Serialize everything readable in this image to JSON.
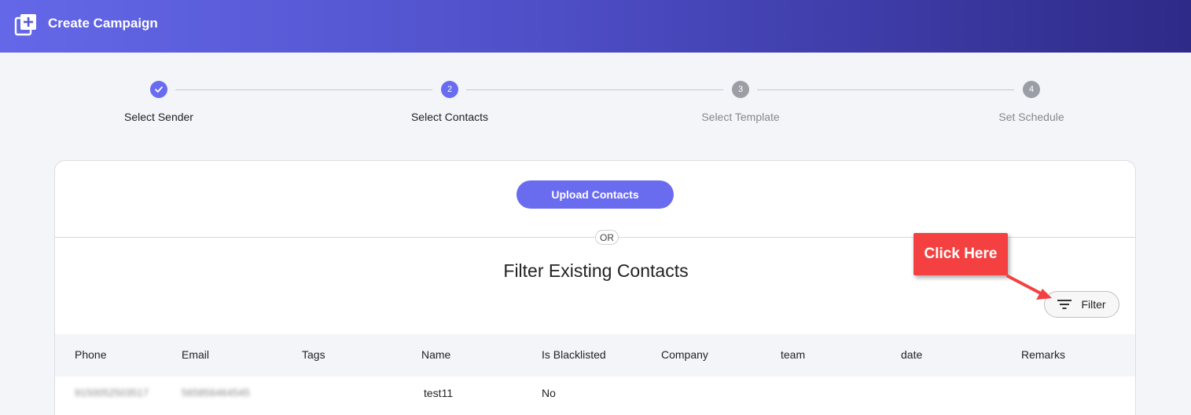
{
  "header": {
    "title": "Create Campaign",
    "icon": "add-box-icon"
  },
  "stepper": {
    "steps": [
      {
        "label": "Select Sender",
        "status": "done",
        "marker": "✓"
      },
      {
        "label": "Select Contacts",
        "status": "current",
        "marker": "2"
      },
      {
        "label": "Select Template",
        "status": "pending",
        "marker": "3"
      },
      {
        "label": "Set Schedule",
        "status": "pending",
        "marker": "4"
      }
    ]
  },
  "upload": {
    "button_label": "Upload Contacts"
  },
  "divider": {
    "or_label": "OR"
  },
  "filter_section": {
    "title": "Filter Existing Contacts",
    "filter_button_label": "Filter",
    "callout_label": "Click Here"
  },
  "table": {
    "columns": [
      "Phone",
      "Email",
      "Tags",
      "Name",
      "Is Blacklisted",
      "Company",
      "team",
      "date",
      "Remarks"
    ],
    "rows": [
      {
        "phone": "9150052503517",
        "email": "565856464545",
        "tags": "",
        "name": "test11",
        "is_blacklisted": "No",
        "company": "",
        "team": "",
        "date": "",
        "remarks": ""
      }
    ]
  },
  "colors": {
    "accent": "#6a6cf0",
    "callout": "#f44040",
    "header_start": "#6468e8",
    "header_end": "#2e2a88"
  }
}
